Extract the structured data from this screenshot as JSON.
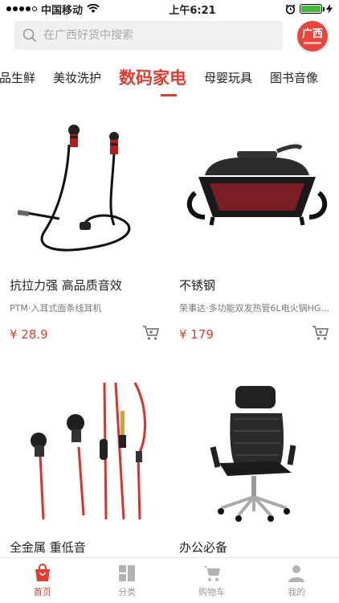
{
  "status_bar": {
    "carrier": "中国移动",
    "time": "上午6:21"
  },
  "search": {
    "placeholder": "在广西好货中搜索"
  },
  "region": {
    "label": "广西"
  },
  "tabs": [
    {
      "label": "食品生鲜"
    },
    {
      "label": "美妆洗护"
    },
    {
      "label": "数码家电"
    },
    {
      "label": "母婴玩具"
    },
    {
      "label": "图书音像"
    }
  ],
  "products": [
    {
      "title": "抗拉力强 高品质音效",
      "subtitle": "PTM·入耳式面条线耳机",
      "price": "¥ 28.9"
    },
    {
      "title": "不锈钢",
      "subtitle": "荣事达·多功能双发热管6L电火锅HG...",
      "price": "¥ 179"
    },
    {
      "title": "全金属 重低音",
      "subtitle": "",
      "price": ""
    },
    {
      "title": "办公必备",
      "subtitle": "",
      "price": ""
    }
  ],
  "bottom_nav": [
    {
      "label": "首页"
    },
    {
      "label": "分类"
    },
    {
      "label": "购物车"
    },
    {
      "label": "我的"
    }
  ],
  "colors": {
    "accent": "#e23b30",
    "subtitle_gray": "#777777"
  }
}
